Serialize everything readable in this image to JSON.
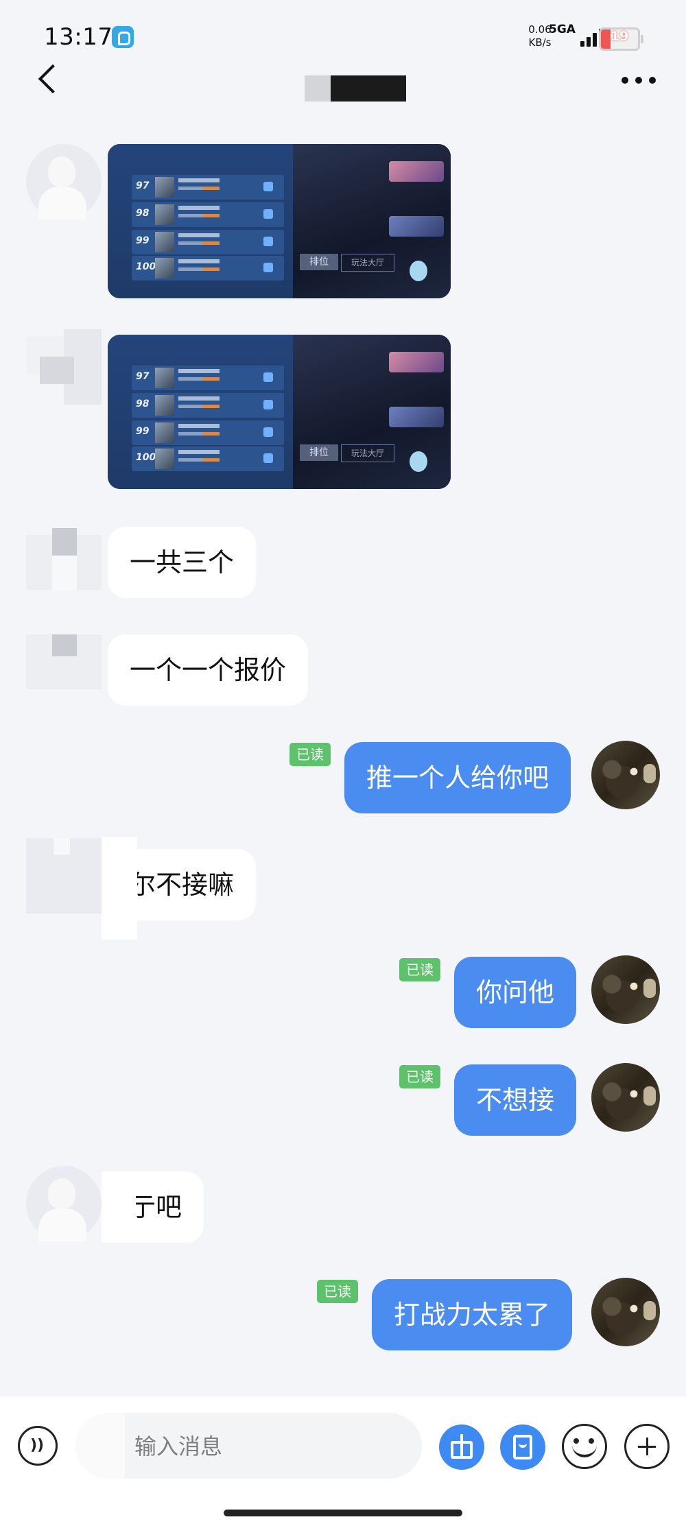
{
  "status_bar": {
    "time": "13:17",
    "net_speed_value": "0.06",
    "net_speed_unit": "KB/s",
    "network_type": "5GA",
    "battery_level": "19",
    "battery_color": "#f05555"
  },
  "nav": {
    "back_icon": "chevron-left-icon",
    "more_icon": "more-horizontal-icon"
  },
  "messages": [
    {
      "type": "image",
      "direction": "incoming"
    },
    {
      "type": "image",
      "direction": "incoming"
    },
    {
      "type": "text",
      "direction": "incoming",
      "text": "一共三个"
    },
    {
      "type": "text",
      "direction": "incoming",
      "text": "一个一个报价"
    },
    {
      "type": "text",
      "direction": "outgoing",
      "text": "推一个人给你吧",
      "read": "已读"
    },
    {
      "type": "text",
      "direction": "incoming",
      "text": "尔不接嘛"
    },
    {
      "type": "text",
      "direction": "outgoing",
      "text": "你问他",
      "read": "已读"
    },
    {
      "type": "text",
      "direction": "outgoing",
      "text": "不想接",
      "read": "已读"
    },
    {
      "type": "text",
      "direction": "incoming",
      "text": "亍吧"
    },
    {
      "type": "text",
      "direction": "outgoing",
      "text": "打战力太累了",
      "read": "已读"
    }
  ],
  "screenshot_text": {
    "ranks_1": [
      "97",
      "98",
      "99",
      "100"
    ],
    "ranks_2": [
      "97",
      "98",
      "99",
      "100"
    ],
    "rank_button": "排位",
    "hall_button": "玩法大厅"
  },
  "input": {
    "placeholder": "输入消息",
    "voice_icon": "voice-icon",
    "gift_icon": "gift-icon",
    "redpacket_icon": "red-packet-icon",
    "emoji_icon": "emoji-icon",
    "plus_icon": "plus-icon"
  },
  "colors": {
    "outgoing_bubble": "#4a8cf0",
    "read_badge": "#5ec26d",
    "background": "#f3f5f9"
  }
}
